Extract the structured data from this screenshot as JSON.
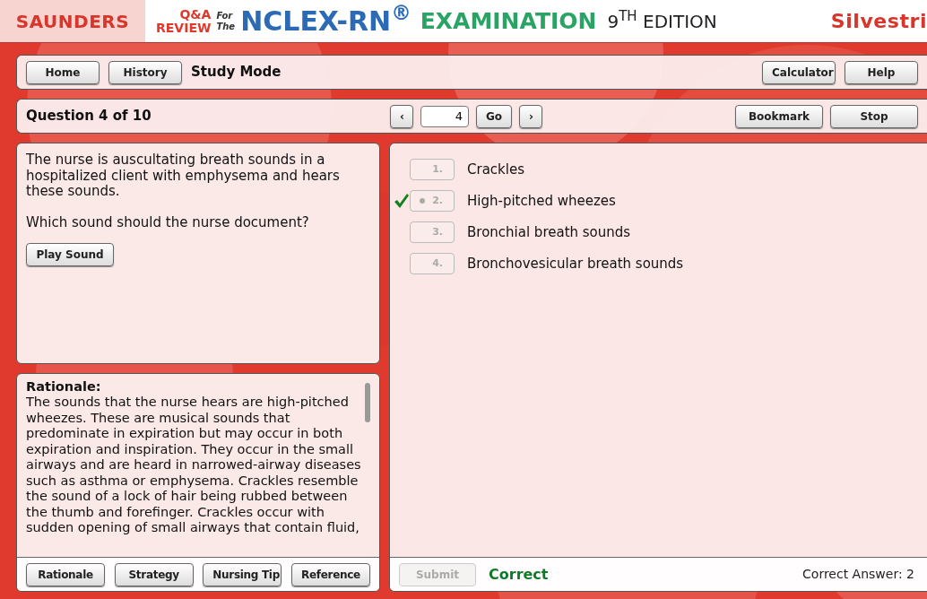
{
  "header": {
    "publisher": "SAUNDERS",
    "qa": "Q&A",
    "review": "REVIEW",
    "for": "For",
    "the": "The",
    "title": "NCLEX-RN$^{®}$",
    "exam": "EXAMINATION",
    "edition": "9$^{TH}$ EDITION",
    "author": "Silvestri"
  },
  "toolbar": {
    "left_buttons": [
      "Home",
      "History"
    ],
    "mode": "Study Mode",
    "right_buttons": [
      "Calculator",
      "Help"
    ]
  },
  "navigation": {
    "question_label": "Question 4 of 10",
    "prev": "‹",
    "page_value": "4",
    "go": "Go",
    "next": "›",
    "right_buttons": [
      "Bookmark",
      "Stop"
    ]
  },
  "question": {
    "text": "The nurse is auscultating breath sounds in a hospitalized client with emphysema and hears these sounds.",
    "prompt": "Which sound should the nurse document?",
    "play_button": "Play Sound"
  },
  "rationale": {
    "heading": "Rationale:",
    "text": "The sounds that the nurse hears are high-pitched wheezes. These are musical sounds that predominate in expiration but may occur in both expiration and inspiration. They occur in the small airways and are heard in narrowed-airway diseases such as asthma or emphysema. Crackles resemble the sound of a lock of hair being rubbed between the thumb and forefinger. Crackles occur with sudden opening of small airways that contain fluid,",
    "tabs": [
      "Rationale",
      "Strategy",
      "Nursing Tip",
      "Reference"
    ]
  },
  "options": [
    {
      "number": "1.",
      "text": "Crackles",
      "selected": false,
      "marked_correct": false
    },
    {
      "number": "2.",
      "text": "High-pitched wheezes",
      "selected": true,
      "marked_correct": true
    },
    {
      "number": "3.",
      "text": "Bronchial breath sounds",
      "selected": false,
      "marked_correct": false
    },
    {
      "number": "4.",
      "text": "Bronchovesicular breath sounds",
      "selected": false,
      "marked_correct": false
    }
  ],
  "footer": {
    "submit": {
      "label": "Submit",
      "disabled": true
    },
    "result": "Correct",
    "correct_answer": "Correct Answer: 2"
  }
}
